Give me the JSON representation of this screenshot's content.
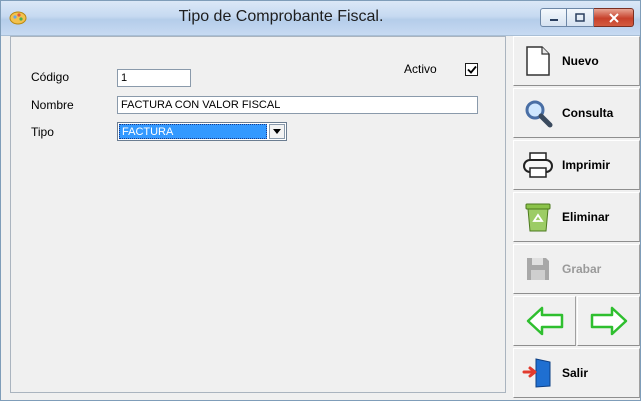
{
  "window": {
    "title": "Tipo de Comprobante Fiscal."
  },
  "form": {
    "codigo": {
      "label": "Código",
      "value": "1"
    },
    "nombre": {
      "label": "Nombre",
      "value": "FACTURA CON VALOR FISCAL"
    },
    "tipo": {
      "label": "Tipo",
      "value": "FACTURA"
    },
    "activo": {
      "label": "Activo",
      "checked": true
    }
  },
  "toolbar": {
    "nuevo": "Nuevo",
    "consulta": "Consulta",
    "imprimir": "Imprimir",
    "eliminar": "Eliminar",
    "grabar": "Grabar",
    "salir": "Salir"
  },
  "icons": {
    "nuevo": "new-document-icon",
    "consulta": "magnifier-icon",
    "imprimir": "printer-icon",
    "eliminar": "recycle-bin-icon",
    "grabar": "floppy-disk-icon",
    "anterior": "arrow-left-icon",
    "siguiente": "arrow-right-icon",
    "salir": "exit-door-icon"
  },
  "colors": {
    "selection": "#3399ff",
    "nav_arrow": "#2fbf2f",
    "close_button": "#c7412b"
  }
}
